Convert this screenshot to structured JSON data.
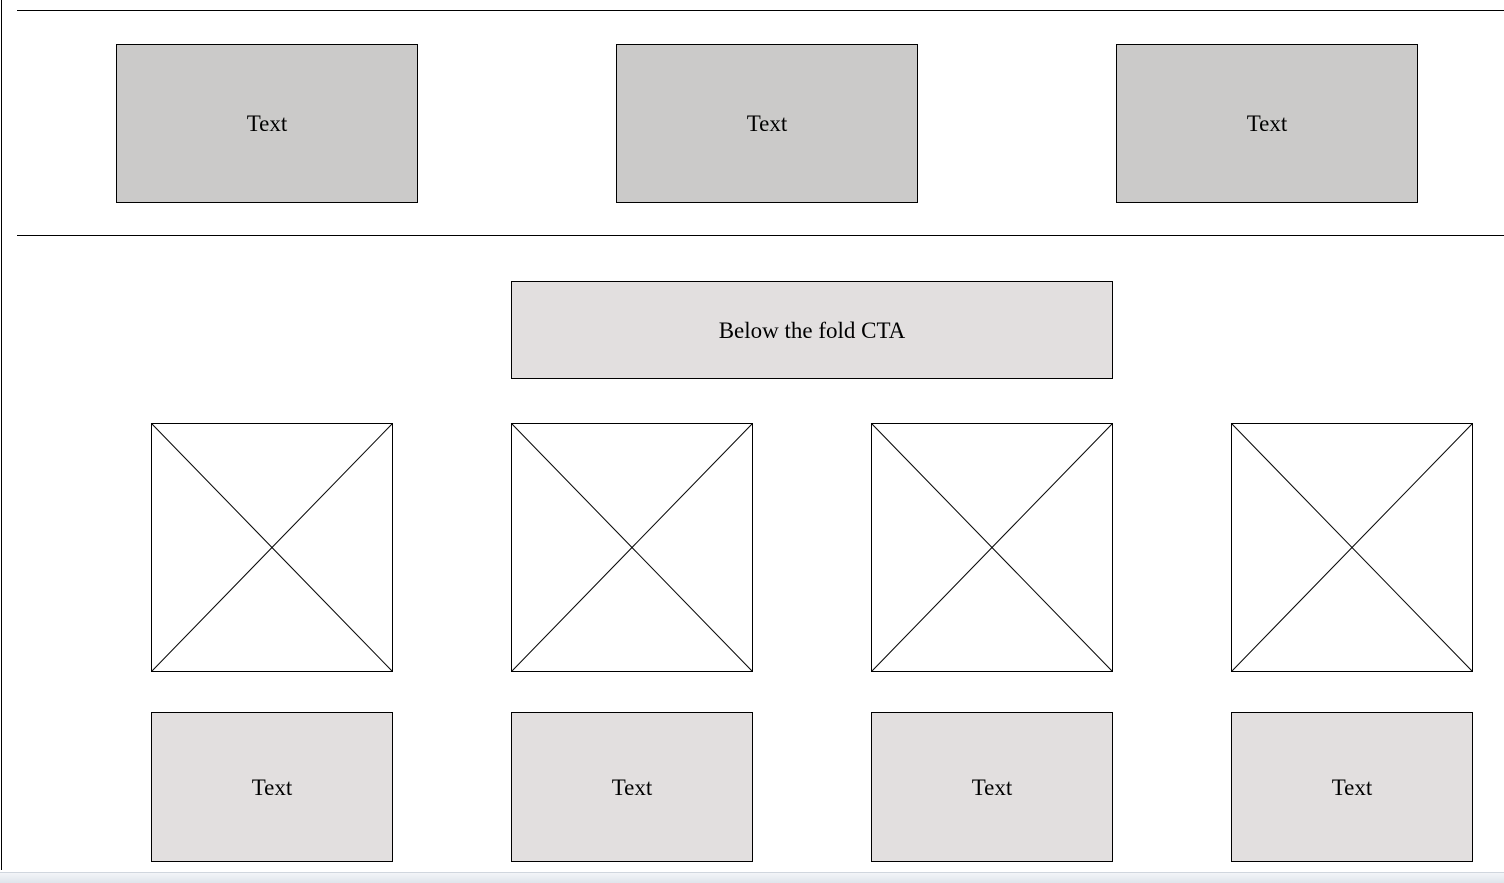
{
  "top_row": {
    "items": [
      {
        "label": "Text"
      },
      {
        "label": "Text"
      },
      {
        "label": "Text"
      }
    ]
  },
  "cta": {
    "label": "Below the fold CTA"
  },
  "image_row": {
    "items": [
      {
        "icon": "image-placeholder-icon"
      },
      {
        "icon": "image-placeholder-icon"
      },
      {
        "icon": "image-placeholder-icon"
      },
      {
        "icon": "image-placeholder-icon"
      }
    ]
  },
  "bottom_row": {
    "items": [
      {
        "label": "Text"
      },
      {
        "label": "Text"
      },
      {
        "label": "Text"
      },
      {
        "label": "Text"
      }
    ]
  },
  "colors": {
    "top_box_fill": "#cbcac9",
    "light_box_fill": "#e2dfdf",
    "stroke": "#000000",
    "background": "#ffffff"
  }
}
